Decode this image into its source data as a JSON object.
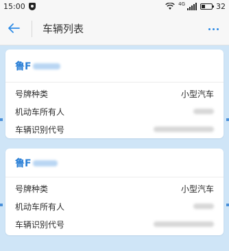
{
  "status_bar": {
    "time": "15:00",
    "network": "4G",
    "battery": "32"
  },
  "nav": {
    "title": "车辆列表"
  },
  "vehicles": [
    {
      "plate_prefix": "鲁F",
      "fields": [
        {
          "label": "号牌种类",
          "value": "小型汽车"
        },
        {
          "label": "机动车所有人",
          "value": ""
        },
        {
          "label": "车辆识别代号",
          "value": ""
        }
      ]
    },
    {
      "plate_prefix": "鲁F",
      "fields": [
        {
          "label": "号牌种类",
          "value": "小型汽车"
        },
        {
          "label": "机动车所有人",
          "value": ""
        },
        {
          "label": "车辆识别代号",
          "value": ""
        }
      ]
    }
  ],
  "colors": {
    "accent": "#2a7fd6",
    "page_background": "#cfe5f7",
    "bar_background": "#f7f7f7"
  }
}
